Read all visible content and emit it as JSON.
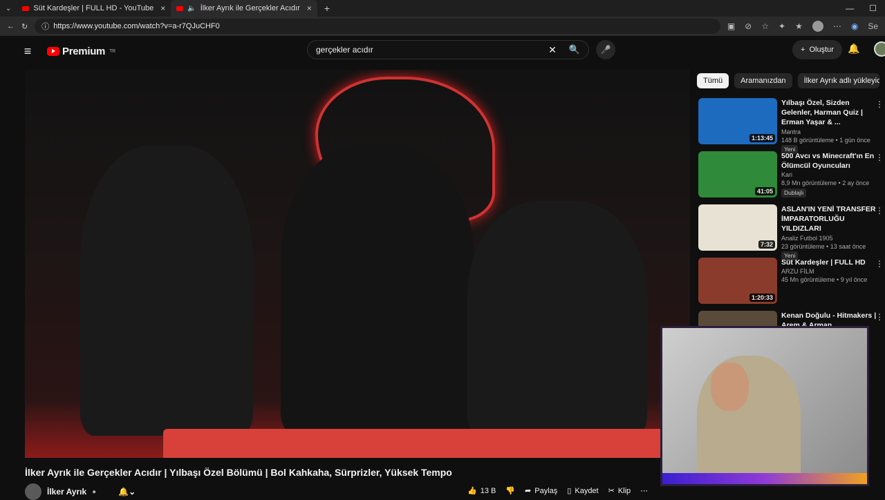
{
  "browser": {
    "tabs": [
      {
        "label": "Süt Kardeşler | FULL HD - YouTube",
        "active": false
      },
      {
        "label": "İlker Ayrık ile Gerçekler Acıdır",
        "active": true
      }
    ],
    "url": "https://www.youtube.com/watch?v=a-r7QJuCHF0",
    "new_tab": "+",
    "profile_label": "Se"
  },
  "masthead": {
    "logo_text": "Premium",
    "logo_country": "TR",
    "search_value": "gerçekler acıdır",
    "create_label": "Oluştur"
  },
  "video": {
    "title": "İlker Ayrık ile Gerçekler Acıdır | Yılbaşı Özel Bölümü | Bol Kahkaha, Sürprizler, Yüksek Tempo",
    "channel": "İlker Ayrık",
    "likes": "13 B",
    "share": "Paylaş",
    "save": "Kaydet",
    "clip": "Klip"
  },
  "chips": [
    "Tümü",
    "Aramanızdan",
    "İlker Ayrık adlı yükleyici"
  ],
  "recommendations": [
    {
      "title": "Yılbaşı Özel, Sizden Gelenler, Harman Quiz | Erman Yaşar & ...",
      "channel": "Mantra",
      "stats": "148 B görüntüleme • 1 gün önce",
      "badge": "Yeni",
      "duration": "1:13:45",
      "thumb_color": "#1c6bbf"
    },
    {
      "title": "500 Avcı vs Minecraft'ın En Ölümcül Oyuncuları",
      "channel": "Kari",
      "stats": "8,9 Mn görüntüleme • 2 ay önce",
      "badge": "Dublajlı",
      "duration": "41:05",
      "thumb_color": "#2f8a3a"
    },
    {
      "title": "ASLAN'IN YENİ TRANSFER İMPARATORLUĞU YILDIZLARI",
      "channel": "Analiz Futbol 1905",
      "stats": "23 görüntüleme • 13 saat önce",
      "badge": "Yeni",
      "duration": "7:32",
      "thumb_color": "#e8e2d4"
    },
    {
      "title": "Süt Kardeşler | FULL HD",
      "channel": "ARZU FİLM",
      "stats": "45 Mn görüntüleme • 9 yıl önce",
      "badge": "",
      "duration": "1:20:33",
      "thumb_color": "#8a3b2b"
    },
    {
      "title": "Kenan Doğulu - Hitmakers | Arem & Arman",
      "channel": "",
      "stats": "",
      "badge": "",
      "duration": "",
      "thumb_color": "#5a4a3a"
    }
  ]
}
